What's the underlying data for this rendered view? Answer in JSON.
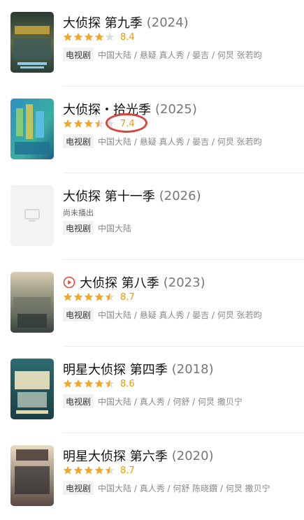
{
  "items": [
    {
      "title": "大侦探 第九季",
      "year": "(2024)",
      "score": "8.4",
      "stars": [
        1,
        1,
        1,
        1,
        0
      ],
      "tag": "电视剧",
      "meta": "中国大陆 / 悬疑 真人秀 / 晏吉 / 何炅 张若昀",
      "status": "",
      "poster": "poster-dazhentan-9"
    },
    {
      "title": "大侦探・拾光季",
      "year": "(2025)",
      "score": "7.4",
      "stars": [
        1,
        1,
        1,
        0.5,
        0
      ],
      "tag": "电视剧",
      "meta": "中国大陆 / 悬疑 真人秀 / 晏吉 / 何炅 张若昀",
      "status": "",
      "poster": "poster-dazhentan-shiguang"
    },
    {
      "title": "大侦探 第十一季",
      "year": "(2026)",
      "score": "",
      "stars": [],
      "tag": "电视剧",
      "meta": "中国大陆",
      "status": "尚未播出",
      "poster": "poster-placeholder"
    },
    {
      "title": "大侦探 第八季",
      "year": "(2023)",
      "score": "8.7",
      "stars": [
        1,
        1,
        1,
        1,
        0.5
      ],
      "tag": "电视剧",
      "meta": "中国大陆 / 悬疑 真人秀 / 晏吉 / 何炅 张若昀",
      "status": "",
      "poster": "poster-dazhentan-8",
      "play_icon": "play-circle-icon"
    },
    {
      "title": "明星大侦探 第四季",
      "year": "(2018)",
      "score": "8.6",
      "stars": [
        1,
        1,
        1,
        1,
        0.5
      ],
      "tag": "电视剧",
      "meta": "中国大陆 / 真人秀 / 何舒 / 何炅 撒贝宁",
      "status": "",
      "poster": "poster-mingxing-4"
    },
    {
      "title": "明星大侦探 第六季",
      "year": "(2020)",
      "score": "8.7",
      "stars": [
        1,
        1,
        1,
        1,
        0.5
      ],
      "tag": "电视剧",
      "meta": "中国大陆 / 真人秀 / 何舒 陈晓鑽 / 何炅 撒贝宁",
      "status": "",
      "poster": "poster-mingxing-6"
    }
  ],
  "colors": {
    "star": "#f5a623",
    "star_empty": "#dddddd",
    "score": "#f09a00",
    "annotation": "#d9443b",
    "play": "#e84a3a"
  }
}
